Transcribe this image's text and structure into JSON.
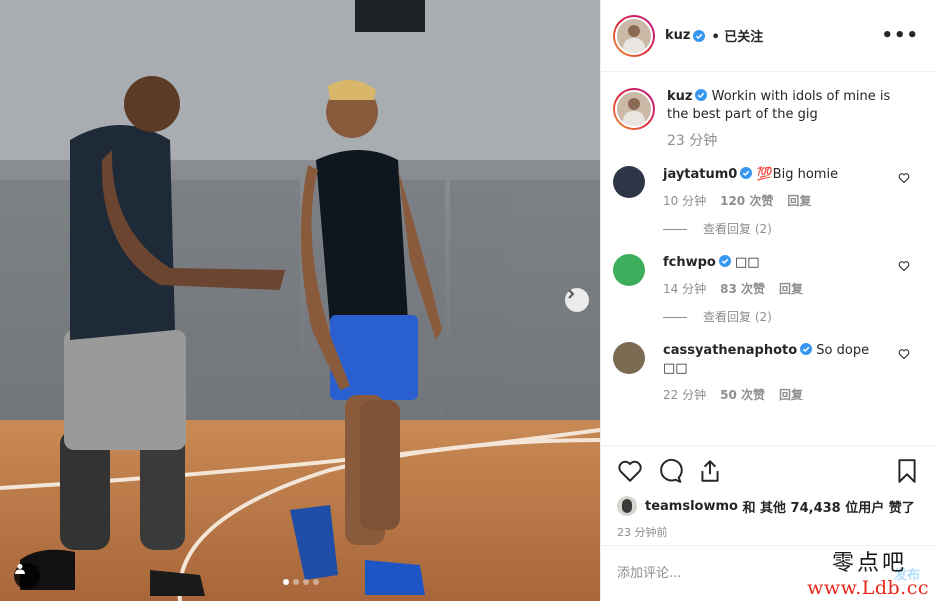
{
  "post": {
    "author": "kuz",
    "follow_status": "• 已关注",
    "more_label": "•••",
    "caption": "Workin with idols of mine is the best part of the gig",
    "caption_time": "23 分钟",
    "carousel_dots": 4,
    "carousel_active": 1
  },
  "comments": [
    {
      "user": "jaytatum0",
      "verified": true,
      "text": "💯Big homie",
      "time": "10 分钟",
      "likes": "120 次赞",
      "reply": "回复",
      "view_replies": "查看回复 (2)",
      "avatar_color": "#2d3546"
    },
    {
      "user": "fchwpo",
      "verified": true,
      "text": "□□",
      "time": "14 分钟",
      "likes": "83 次赞",
      "reply": "回复",
      "view_replies": "查看回复 (2)",
      "avatar_color": "#3fae5c"
    },
    {
      "user": "cassyathenaphoto",
      "verified": true,
      "text": "So dope □□",
      "time": "22 分钟",
      "likes": "50 次赞",
      "reply": "回复",
      "view_replies": "",
      "avatar_color": "#7a6a52"
    }
  ],
  "likes": {
    "user": "teamslowmo",
    "text": "和 其他 74,438 位用户 赞了",
    "time_ago": "23 分钟前"
  },
  "add_comment": {
    "placeholder": "添加评论...",
    "post_label": "发布"
  },
  "watermark": {
    "line1": "零点吧",
    "line2": "www.Ldb.cc"
  },
  "colors": {
    "verified": "#3897f0",
    "muted": "#8e8e8e",
    "post_disabled": "#b2dffc"
  }
}
